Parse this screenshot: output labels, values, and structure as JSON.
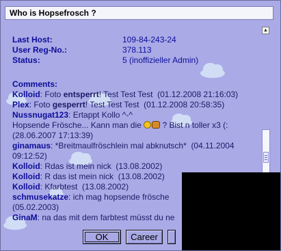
{
  "dialog": {
    "title": "Who is Hopsefrosch ?"
  },
  "info": [
    {
      "label": "Last Host",
      "suffix": ":",
      "value": "109-84-243-24"
    },
    {
      "label": "User Reg-No.",
      "suffix": ":",
      "value": "378.113"
    },
    {
      "label": "Status",
      "suffix": ":",
      "value": "5 (inoffizieller Admin)"
    }
  ],
  "comments_label": "Comments",
  "comments": [
    {
      "user": "Kolloid",
      "pre": ": Foto ",
      "bold": "entsperrt",
      "post": "! Test Test Test  (01.12.2008 21:16:03)"
    },
    {
      "user": "Plex",
      "pre": ": Foto ",
      "bold": "gesperrt",
      "post": "! Test Test Test  (01.12.2008 20:58:35)"
    },
    {
      "user": "Nussnugat123",
      "pre": ": Ertappt Kollo ^-^",
      "bold": "",
      "post": ""
    },
    {
      "user": "",
      "pre": "Hopsende Frösche... Kann man die ",
      "bold": "",
      "post": " ? Bist n toller x3 (:",
      "emoji": true
    },
    {
      "user": "",
      "pre": "(28.06.2007 17:13:39)",
      "bold": "",
      "post": ""
    },
    {
      "user": "ginamaus",
      "pre": ": *Breitmaulfröschlein mal abknutsch*  (04.11.2004",
      "bold": "",
      "post": ""
    },
    {
      "user": "",
      "pre": "09:12:52)",
      "bold": "",
      "post": ""
    },
    {
      "user": "Kolloid",
      "pre": ": Rdas ist mein nick  (13.08.2002)",
      "bold": "",
      "post": ""
    },
    {
      "user": "Kolloid",
      "pre": ": R das ist mein nick  (13.08.2002)",
      "bold": "",
      "post": ""
    },
    {
      "user": "Kolloid",
      "pre": ": Kfarbtest  (13.08.2002)",
      "bold": "",
      "post": ""
    },
    {
      "user": "schmusekatze",
      "pre": ": ich mag hopsende frösche",
      "bold": "",
      "post": ""
    },
    {
      "user": "",
      "pre": "(05.02.2003)",
      "bold": "",
      "post": ""
    },
    {
      "user": "GinaM",
      "pre": ": na das mit dem farbtest müsst du ne",
      "bold": "",
      "post": ""
    }
  ],
  "buttons": {
    "ok": "OK",
    "career": "Career",
    "more": ""
  },
  "scrollbar": {
    "up_glyph": "▲"
  }
}
